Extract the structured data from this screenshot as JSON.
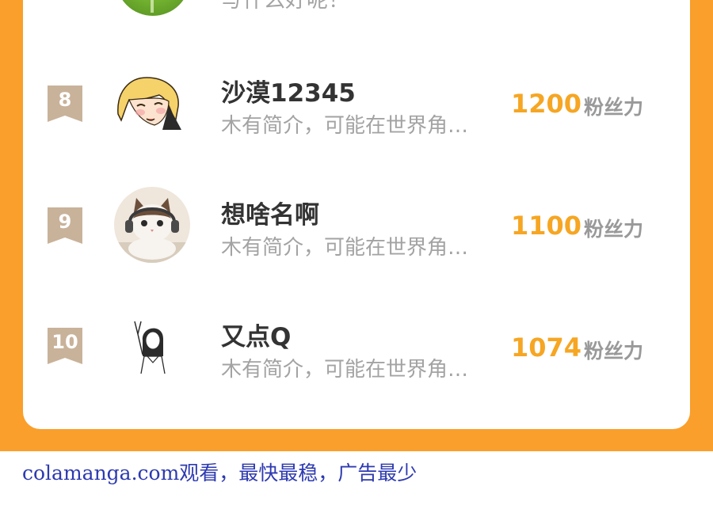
{
  "partial_row": {
    "description": "写什么好呢！"
  },
  "ranking": [
    {
      "rank": "8",
      "name": "沙漠12345",
      "description": "木有简介，可能在世界角…",
      "score": "1200",
      "score_label": "粉丝力",
      "avatar_icon": "anime-blonde-girl-avatar"
    },
    {
      "rank": "9",
      "name": "想啥名啊",
      "description": "木有简介，可能在世界角…",
      "score": "1100",
      "score_label": "粉丝力",
      "avatar_icon": "cat-with-headphones-avatar"
    },
    {
      "rank": "10",
      "name": "又点Q",
      "description": "木有简介，可能在世界角…",
      "score": "1074",
      "score_label": "粉丝力",
      "avatar_icon": "sketch-girl-avatar"
    }
  ],
  "footer": {
    "watermark_text": "colamanga.com观看，最快最稳，广告最少"
  },
  "colors": {
    "frame": "#fa9f2b",
    "score": "#f6a623",
    "rank_badge": "#c9b29a",
    "footer_text": "#2d3ab0"
  }
}
